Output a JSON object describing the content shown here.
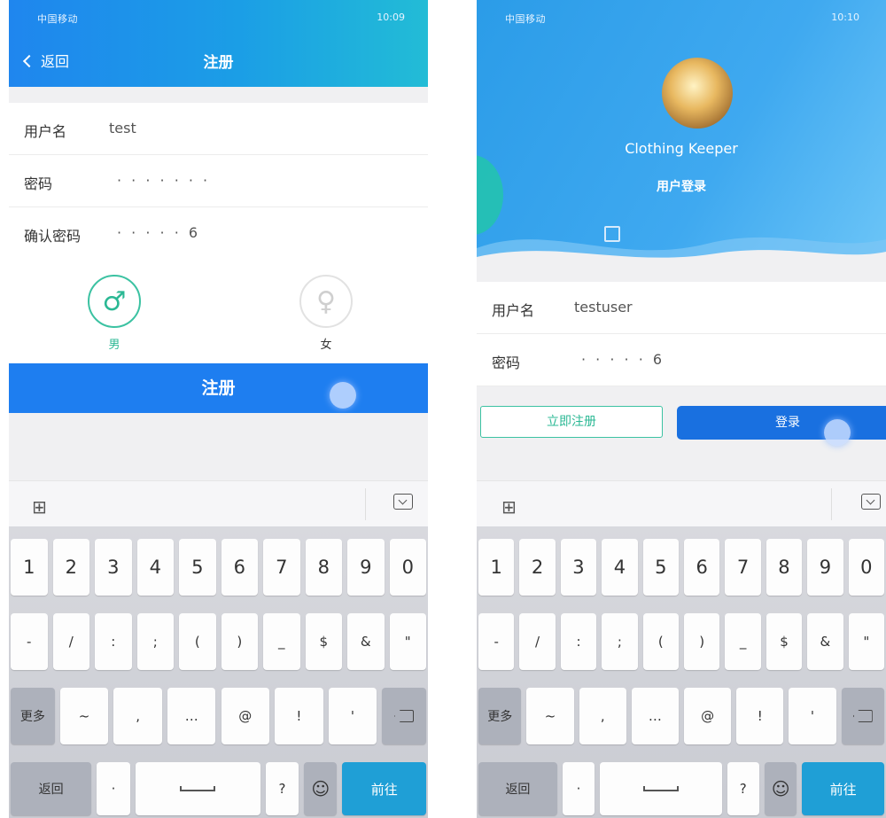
{
  "status": {
    "left_carrier": "中国移动",
    "left_time": "10:09",
    "right_carrier": "中国移动",
    "right_time": "10:10"
  },
  "register": {
    "back_label": "返回",
    "title": "注册",
    "fields": [
      {
        "label": "用户名",
        "value": "test"
      },
      {
        "label": "密码",
        "value": "· · · · · · ·"
      },
      {
        "label": "确认密码",
        "value": "· · · · · 6"
      }
    ],
    "gender": {
      "male_label": "男",
      "female_label": "女",
      "male_icon": "♂",
      "female_icon": "♀",
      "selected": "male"
    },
    "submit_label": "注册"
  },
  "login": {
    "app_name": "Clothing Keeper",
    "title": "用户登录",
    "fields": [
      {
        "label": "用户名",
        "value": "testuser"
      },
      {
        "label": "密码",
        "value": "· · · · · 6"
      }
    ],
    "register_now_label": "立即注册",
    "login_label": "登录"
  },
  "keyboard": {
    "row1": [
      "1",
      "2",
      "3",
      "4",
      "5",
      "6",
      "7",
      "8",
      "9",
      "0"
    ],
    "row2": [
      "-",
      "/",
      ":",
      ";",
      "(",
      ")",
      "_",
      "$",
      "&",
      "\""
    ],
    "row3": [
      "~",
      ",",
      "…",
      "@",
      "!",
      "'"
    ],
    "more_label": "更多",
    "return_label": "返回",
    "dot_label": "·",
    "question_label": "?",
    "emoji": "☺",
    "go_label": "前往"
  },
  "colors": {
    "accent_blue": "#1e7ef0",
    "accent_green": "#2bb894",
    "header_blue": "#1f86ee"
  }
}
